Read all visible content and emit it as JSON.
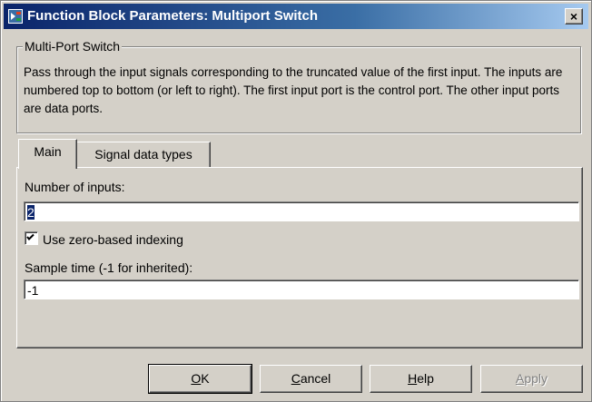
{
  "window": {
    "title": "Function Block Parameters: Multiport Switch",
    "close_label": "×"
  },
  "group": {
    "legend": "Multi-Port Switch",
    "description": "Pass through the input signals corresponding to the truncated value of the first input. The inputs are numbered top to bottom (or left to right). The first input port is the control port. The other input ports are data ports."
  },
  "tabs": [
    {
      "label": "Main",
      "active": true
    },
    {
      "label": "Signal data types",
      "active": false
    }
  ],
  "main": {
    "num_inputs_label": "Number of inputs:",
    "num_inputs_value": "2",
    "zero_index_label": "Use zero-based indexing",
    "zero_index_checked": true,
    "sample_time_label": "Sample time (-1 for inherited):",
    "sample_time_value": "-1"
  },
  "buttons": {
    "ok_mnemonic": "O",
    "ok_rest": "K",
    "cancel_mnemonic": "C",
    "cancel_rest": "ancel",
    "help_mnemonic": "H",
    "help_rest": "elp",
    "apply_mnemonic": "A",
    "apply_rest": "pply"
  },
  "icons": {
    "title_icon": "simulink-block-icon",
    "checkbox_mark": "checkmark-icon"
  },
  "colors": {
    "titlebar_start": "#0a246a",
    "titlebar_end": "#a6caf0",
    "face": "#d4d0c8",
    "selection": "#0a246a"
  }
}
